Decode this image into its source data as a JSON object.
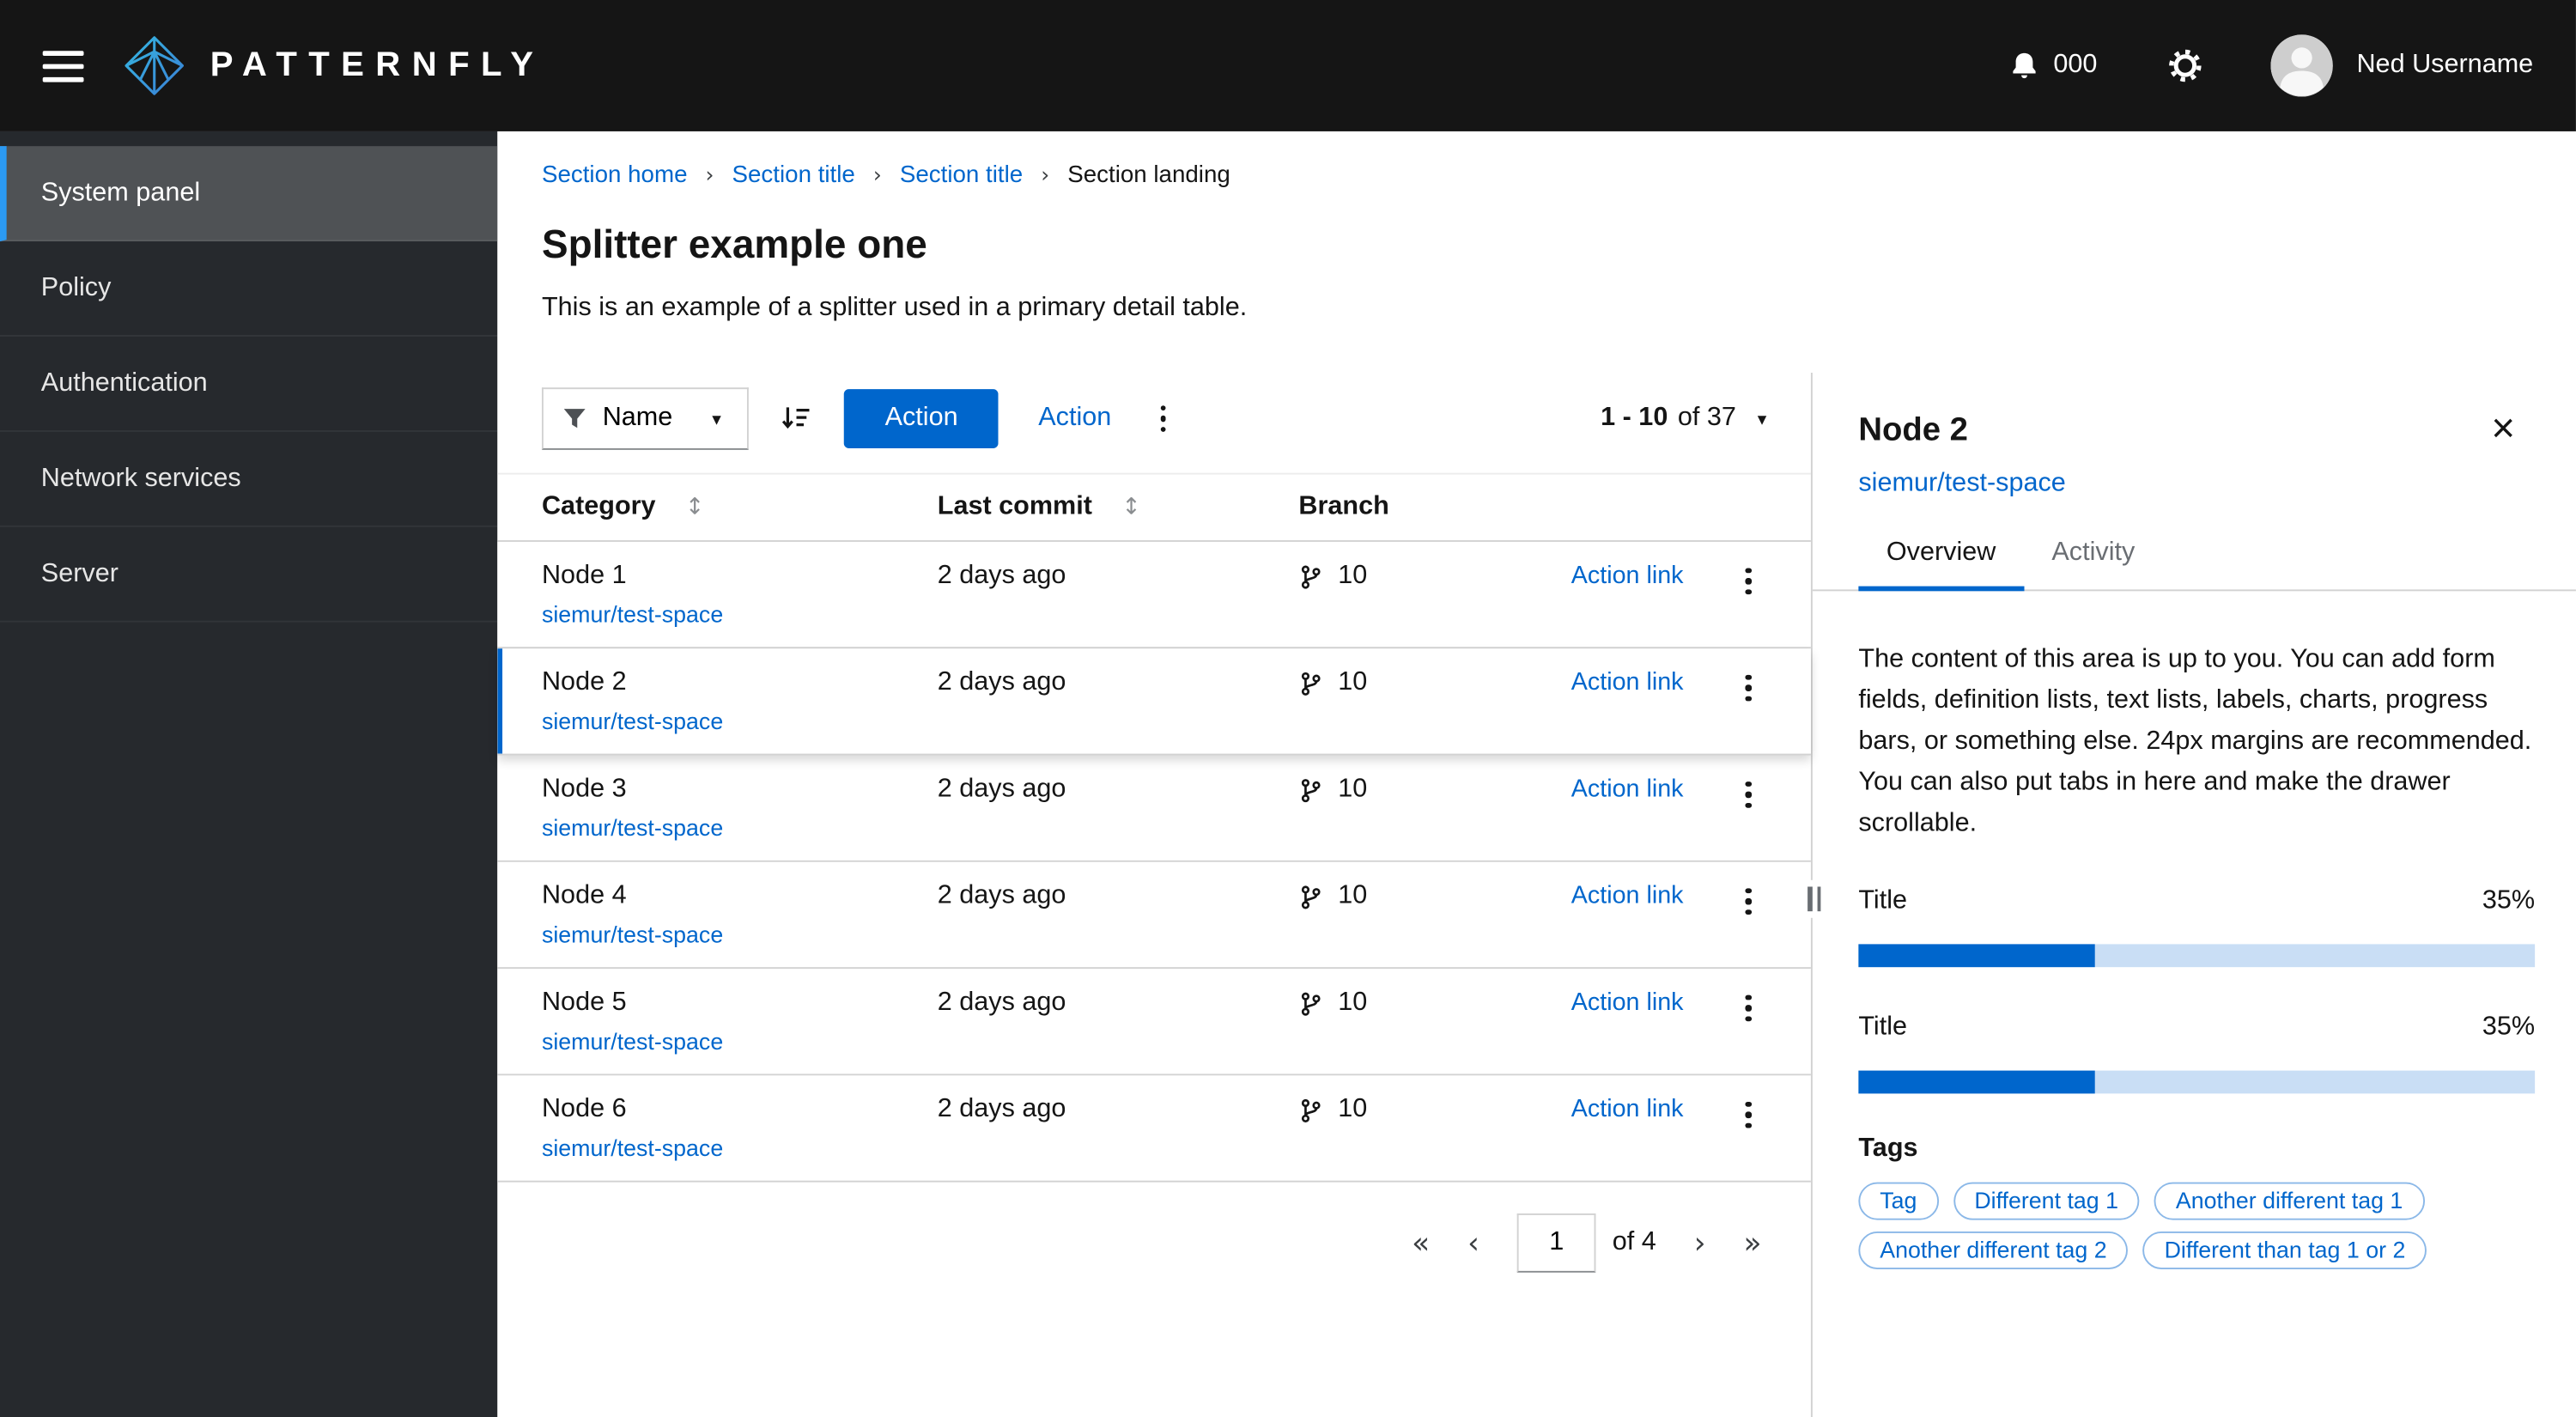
{
  "icons": {
    "caret_down": "▾",
    "sort_both": "↕",
    "close": "×",
    "breadcrumb_separator": "›",
    "pagination_first": "«",
    "pagination_prev": "‹",
    "pagination_next": "›",
    "pagination_last": "»"
  },
  "masthead": {
    "brand": "PATTERNFLY",
    "notification_count": "000",
    "username": "Ned Username"
  },
  "sidebar": {
    "items": [
      {
        "label": "System panel",
        "active": true
      },
      {
        "label": "Policy",
        "active": false
      },
      {
        "label": "Authentication",
        "active": false
      },
      {
        "label": "Network services",
        "active": false
      },
      {
        "label": "Server",
        "active": false
      }
    ]
  },
  "breadcrumb": {
    "items": [
      "Section home",
      "Section title",
      "Section title",
      "Section landing"
    ]
  },
  "page": {
    "title": "Splitter example one",
    "description": "This is an example of a splitter used in a primary detail table."
  },
  "toolbar": {
    "filter_label": "Name",
    "primary_action": "Action",
    "link_action": "Action",
    "pagination_range": "1 - 10",
    "pagination_of": "of 37"
  },
  "table": {
    "columns": [
      "Category",
      "Last commit",
      "Branch"
    ],
    "rows": [
      {
        "name": "Node 1",
        "link": "siemur/test-space",
        "last_commit": "2 days ago",
        "branch_count": "10",
        "action": "Action link",
        "selected": false
      },
      {
        "name": "Node 2",
        "link": "siemur/test-space",
        "last_commit": "2 days ago",
        "branch_count": "10",
        "action": "Action link",
        "selected": true
      },
      {
        "name": "Node 3",
        "link": "siemur/test-space",
        "last_commit": "2 days ago",
        "branch_count": "10",
        "action": "Action link",
        "selected": false
      },
      {
        "name": "Node 4",
        "link": "siemur/test-space",
        "last_commit": "2 days ago",
        "branch_count": "10",
        "action": "Action link",
        "selected": false
      },
      {
        "name": "Node 5",
        "link": "siemur/test-space",
        "last_commit": "2 days ago",
        "branch_count": "10",
        "action": "Action link",
        "selected": false
      },
      {
        "name": "Node 6",
        "link": "siemur/test-space",
        "last_commit": "2 days ago",
        "branch_count": "10",
        "action": "Action link",
        "selected": false
      }
    ]
  },
  "footer_pagination": {
    "current_page": "1",
    "of_label": "of 4"
  },
  "drawer": {
    "title": "Node 2",
    "subtitle_link": "siemur/test-space",
    "tabs": [
      {
        "label": "Overview",
        "active": true
      },
      {
        "label": "Activity",
        "active": false
      }
    ],
    "body_text": "The content of this area is up to you. You can add form fields, definition lists, text lists, labels, charts, progress bars, or something else. 24px margins are recommended. You can also put tabs in here and make the drawer scrollable.",
    "progress_bars": [
      {
        "label": "Title",
        "value": "35%",
        "percent": 35
      },
      {
        "label": "Title",
        "value": "35%",
        "percent": 35
      }
    ],
    "tags_label": "Tags",
    "tags": [
      "Tag",
      "Different tag 1",
      "Another different tag 1",
      "Another different tag 2",
      "Different than tag 1 or 2"
    ]
  },
  "colors": {
    "primary_blue": "#0066cc",
    "masthead_bg": "#151515",
    "sidebar_bg": "#26292d",
    "sidebar_active_bg": "#4f5255",
    "nav_active_indicator": "#2b9af3",
    "progress_track": "#c9def5",
    "border": "#d2d2d2"
  }
}
